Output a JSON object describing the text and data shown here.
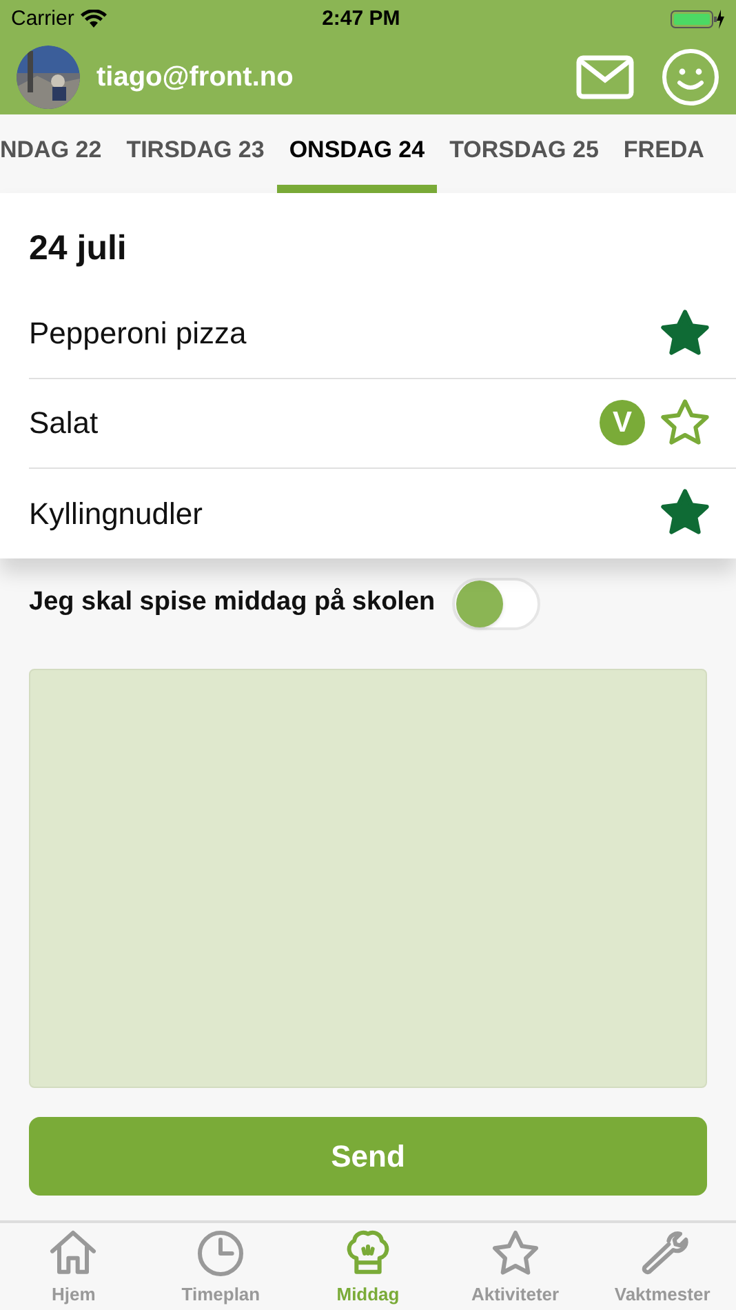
{
  "status_bar": {
    "carrier": "Carrier",
    "time": "2:47 PM"
  },
  "header": {
    "user": "tiago@front.no"
  },
  "tabs": [
    {
      "label": "NDAG 22",
      "selected": false
    },
    {
      "label": "TIRSDAG 23",
      "selected": false
    },
    {
      "label": "ONSDAG 24",
      "selected": true
    },
    {
      "label": "TORSDAG 25",
      "selected": false
    },
    {
      "label": "FREDA",
      "selected": false
    }
  ],
  "date": "24 juli",
  "dishes": [
    {
      "name": "Pepperoni pizza",
      "starred": true
    },
    {
      "name": "Salat",
      "badge": "V",
      "starred": false
    },
    {
      "name": "Kyllingnudler",
      "starred": true
    }
  ],
  "toggle": {
    "label": "Jeg skal spise middag på skolen",
    "on": false
  },
  "send_button": "Send",
  "tab_bar": [
    {
      "label": "Hjem",
      "kind": "home",
      "selected": false
    },
    {
      "label": "Timeplan",
      "kind": "clock",
      "selected": false
    },
    {
      "label": "Middag",
      "kind": "chef",
      "selected": true
    },
    {
      "label": "Aktiviteter",
      "kind": "star",
      "selected": false
    },
    {
      "label": "Vaktmester",
      "kind": "wrench",
      "selected": false
    }
  ]
}
